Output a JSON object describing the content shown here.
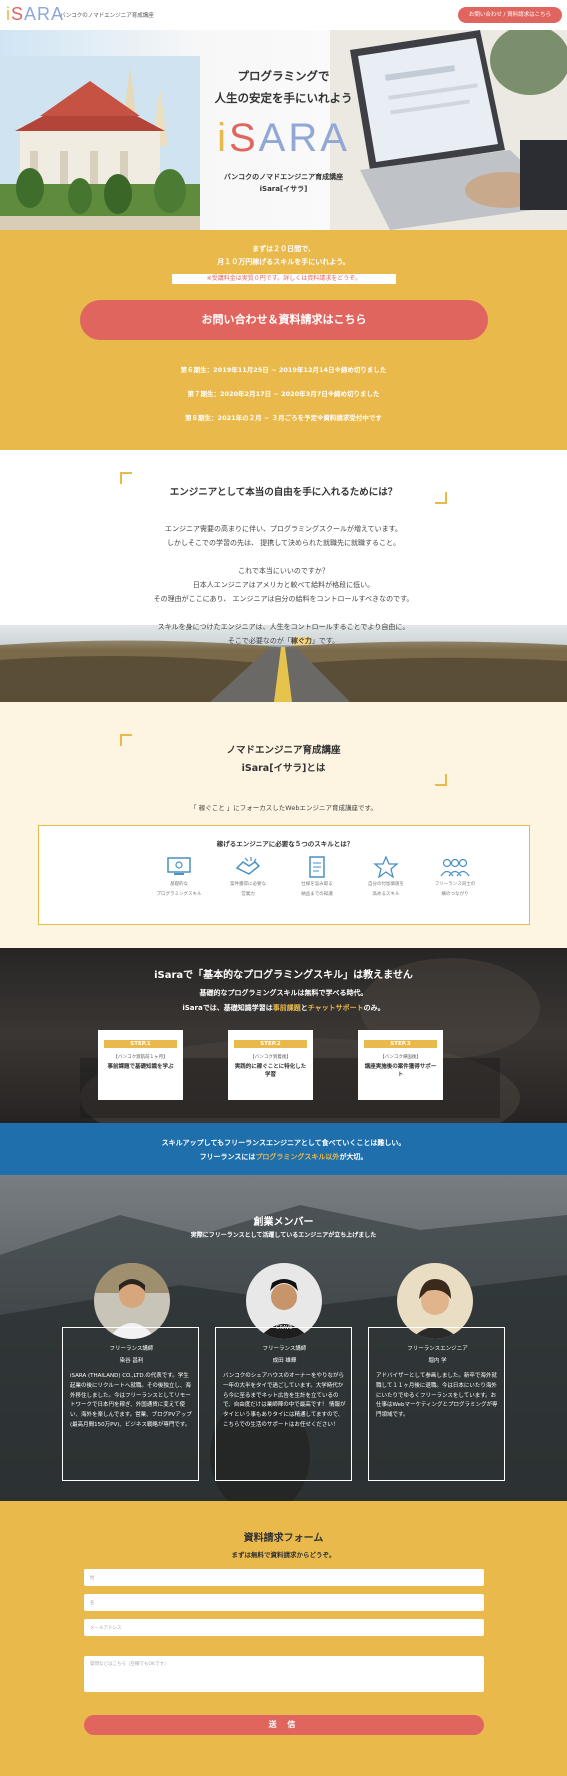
{
  "header": {
    "logo": {
      "p1": "i",
      "p2": "S",
      "p3": "ARA"
    },
    "tagline": "バンコクのノマドエンジニア育成講座",
    "cta": "お問い合わせ / 資料請求はこちら"
  },
  "hero": {
    "title_line1": "プログラミングで",
    "title_line2": "人生の安定を手にいれよう",
    "logo": {
      "p1": "i",
      "p2": "S",
      "p3": "ARA"
    },
    "sub_line1": "バンコクのノマドエンジニア育成講座",
    "sub_line2": "iSara[イサラ]"
  },
  "intro": {
    "line1": "まずは２０日間で、",
    "line2": "月１０万円稼げるスキルを手にいれよう。",
    "note": "※受講料金は実質０円です。詳しくは資料請求をどうぞ。",
    "cta": "お問い合わせ＆資料請求はこちら",
    "terms": [
      "第６期生：2019年11月25日 ~ 2019年12月14日※締め切りました",
      "第７期生：2020年2月17日 ~ 2020年3月7日※締め切りました",
      "第８期生：2021年の２月 ~ ３月ごろを予定※資料請求受付中です"
    ]
  },
  "freedom": {
    "title": "エンジニアとして本当の自由を手に入れるためには？",
    "lines": [
      "エンジニア需要の高まりに伴い、プログラミングスクールが増えています。",
      "しかしそこでの学習の先は、 提携して決められた就職先に就職すること。",
      "これで本当にいいのですか？",
      "日本人エンジニアはアメリカと較べて給料が格段に低い。",
      "その理由がここにあり、 エンジニアは自分の給料をコントロールすべきなのです。",
      "スキルを身につけたエンジニアは、人生をコントロールすることでより自由に。"
    ],
    "last_pre": "そこで必要なのが「",
    "last_hl": "稼ぐ力",
    "last_post": "」です。"
  },
  "nomad": {
    "title_line1": "ノマドエンジニア育成講座",
    "title_line2": "iSara[イサラ]とは",
    "desc": "「 稼ぐこと 」にフォーカスしたWebエンジニア育成講座です。",
    "skills_title": "稼げるエンジニアに必要な５つのスキルとは？",
    "skills": [
      {
        "icon": "computer-icon",
        "l1": "基礎的な",
        "l2": "プログラミングスキル"
      },
      {
        "icon": "handshake-icon",
        "l1": "案件獲得に必要な",
        "l2": "営業力"
      },
      {
        "icon": "document-icon",
        "l1": "仕様を汲み取る",
        "l2": "納品までの知識"
      },
      {
        "icon": "star-person-icon",
        "l1": "自分の付加価値を",
        "l2": "高めるスキル"
      },
      {
        "icon": "community-icon",
        "l1": "フリーランス同士の",
        "l2": "横のつながり"
      }
    ]
  },
  "program": {
    "title_pre": "iSaraで「基本的なプログラミングスキル」は教えません",
    "line1": "基礎的なプログラミングスキルは無料で学べる時代。",
    "line2_pre": "iSaraでは、基礎知識学習は",
    "line2_hl1": "事前課題",
    "line2_mid": "と",
    "line2_hl2": "チャットサポート",
    "line2_post": "のみ。",
    "steps": [
      {
        "label": "STEP.1",
        "sub": "【バンコク渡航前１ヶ月】",
        "desc": "事前課題で基礎知識を学ぶ"
      },
      {
        "label": "STEP.2",
        "sub": "【バンコク到着後】",
        "desc": "実践的に稼ぐことに特化した学習"
      },
      {
        "label": "STEP.3",
        "sub": "【バンコク帰国後】",
        "desc": "講座実施後の案件獲得サポート"
      }
    ]
  },
  "blueband": {
    "line1": "スキルアップしてもフリーランスエンジニアとして食べていくことは難しい。",
    "line2_pre": "フリーランスには",
    "line2_hl": "プログラミングスキル以外",
    "line2_post": "が大切。"
  },
  "members": {
    "title": "創業メンバー",
    "subtitle": "実際にフリーランスとして活躍しているエンジニアが立ち上げました",
    "list": [
      {
        "role": "フリーランス講師",
        "name": "染谷 昌利",
        "bio": "iSARA (THAILAND) CO.,LTD.の代表です。学生起業の後にリクルートへ就職。その後独立し、海外移住しました。今はフリーランスとしてリモートワークで日本円を稼ぎ、外国通貨に変えて使い、海外を楽しんでます。営業、ブログPVアップ(最高月間150万PV)、ビジネス戦略が専門です。"
      },
      {
        "role": "フリーランス講師",
        "name": "成田 雄輝",
        "bio": "バンコクのシェアハウスのオーナーをやりながら一年の大半をタイで過ごしています。大学時代から今に至るまでネット広告を生計を立ているので、自由度だけは業師陣の中で最高です！ 情報がタイという事もありタイには精通してますので、こちらでの生活のサポートはお任せください！"
      },
      {
        "role": "フリーランスエンジニア",
        "name": "堀内 学",
        "bio": "アドバイザーとして参画しました。新卒で海外就職して１１ヶ月後に退職。今は日本にいたり海外にいたりでゆるくフリーランスをしています。お仕事はWebマーケティングとプログラミングが専門領域です。"
      }
    ]
  },
  "form": {
    "title": "資料請求フォーム",
    "subtitle": "まずは無料で資料請求からどうぞ。",
    "fields": [
      {
        "placeholder": "姓"
      },
      {
        "placeholder": "名"
      },
      {
        "placeholder": "メールアドレス"
      }
    ],
    "message_placeholder": "質問などはこちら（空欄でもOKです）",
    "submit": "送 信"
  },
  "colors": {
    "yellow": "#e9b94c",
    "coral": "#e1655f",
    "blue": "#1f6fad",
    "cream": "#fdf4e2"
  }
}
